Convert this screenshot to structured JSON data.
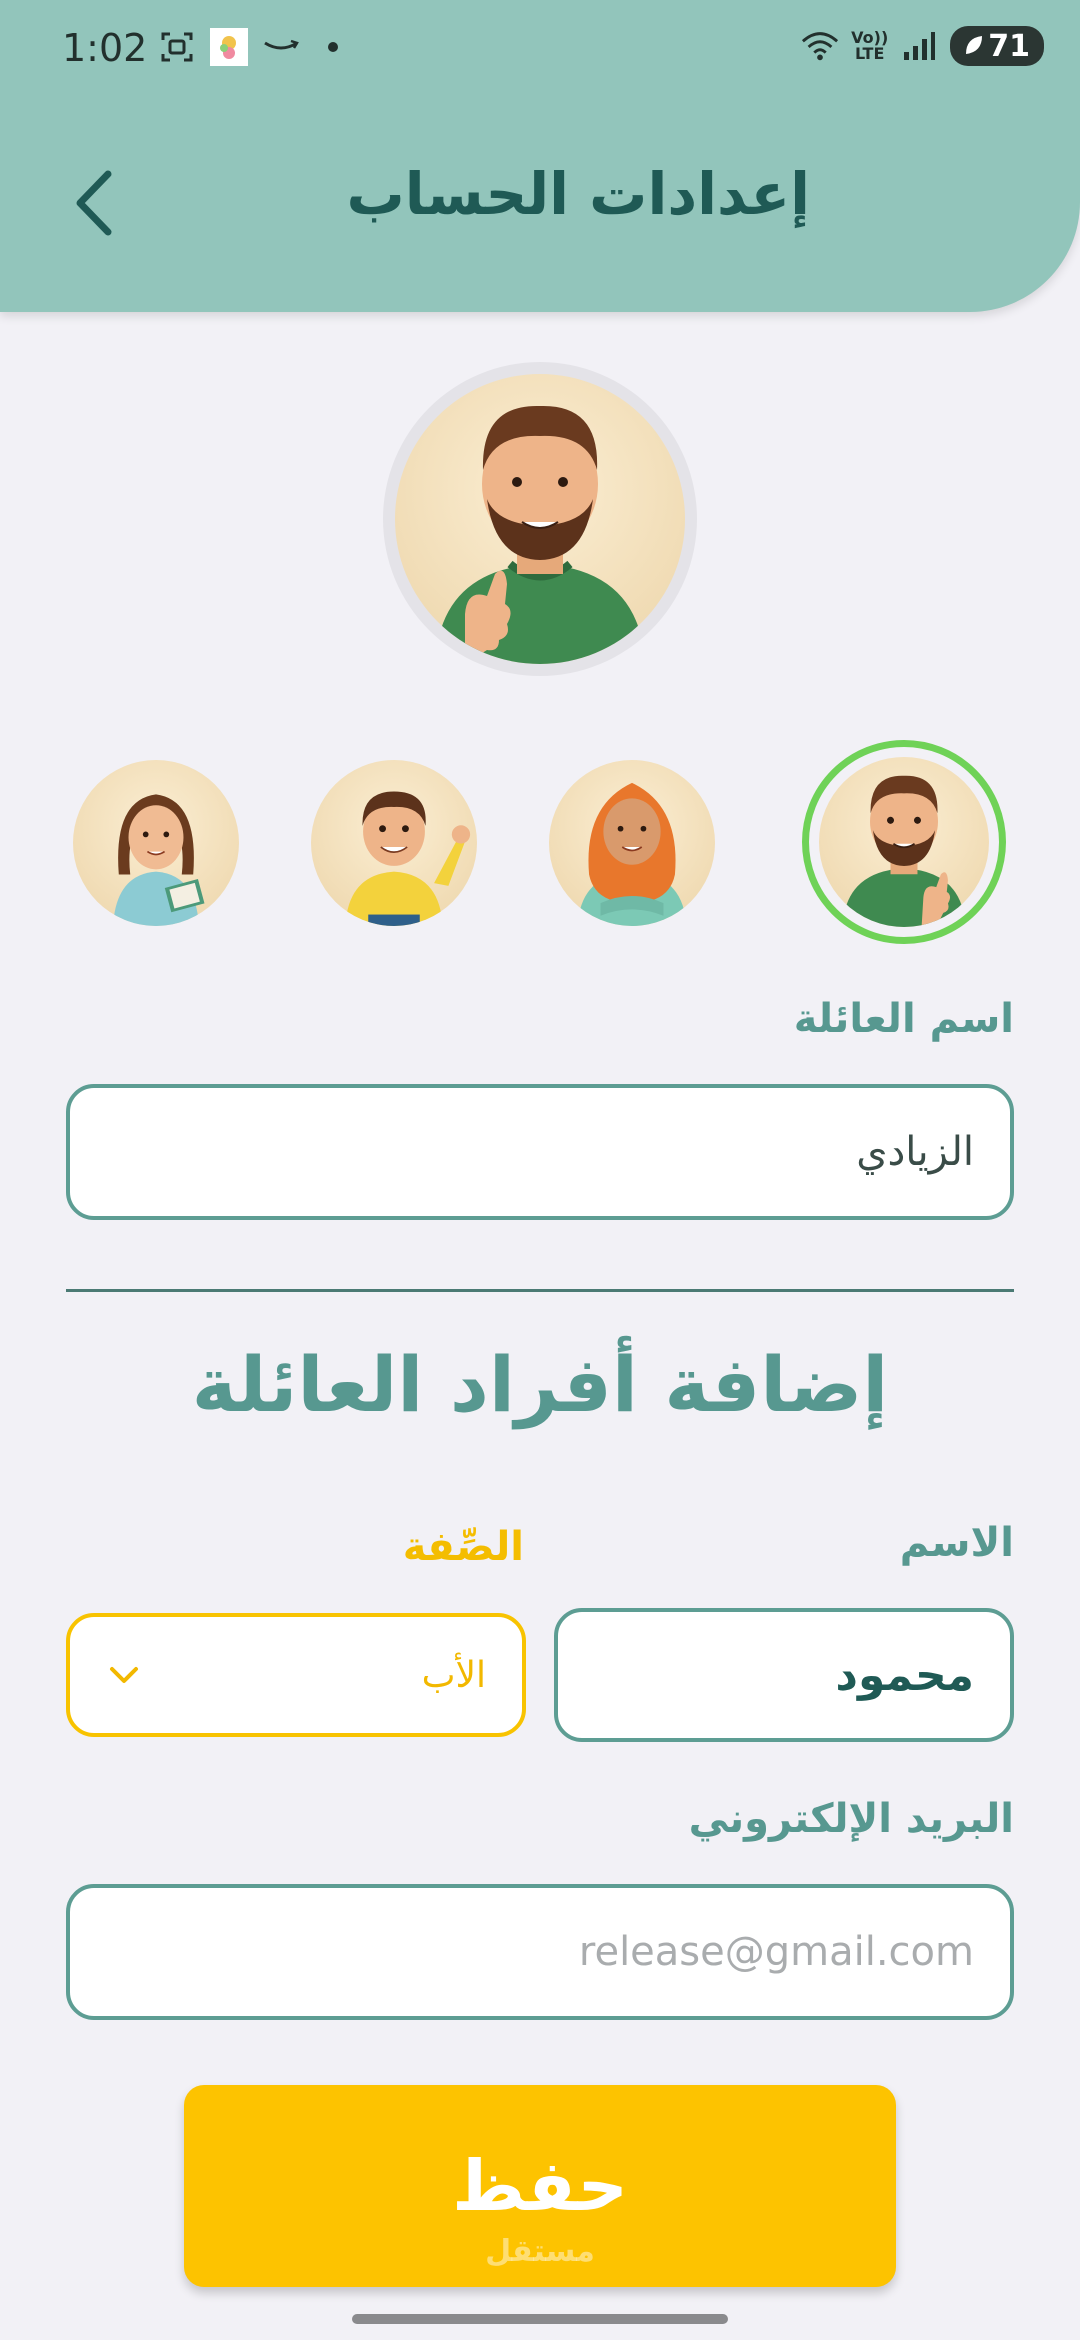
{
  "status_bar": {
    "time": "1:02",
    "volte_top": "Vo))",
    "volte_bottom": "LTE",
    "battery": "71"
  },
  "header": {
    "title": "إعدادات الحساب"
  },
  "avatars": {
    "selected": "father",
    "choices": [
      "father",
      "mother",
      "son",
      "daughter"
    ]
  },
  "family": {
    "label": "اسم العائلة",
    "value": "الزيادي"
  },
  "add_members": {
    "title": "إضافة أفراد العائلة",
    "name_label": "الاسم",
    "name_value": "محمود",
    "role_label": "الصِّفة",
    "role_value": "الأب",
    "email_label": "البريد الإلكتروني",
    "email_placeholder": "release@gmail.com"
  },
  "actions": {
    "save_label": "حفظ",
    "watermark": "مستقل"
  },
  "colors": {
    "header_bg": "#92c5bb",
    "title": "#1f5a55",
    "label": "#579890",
    "field_border": "#5d9d93",
    "accent_yellow": "#fdc300",
    "selected_ring": "#6fd257"
  }
}
